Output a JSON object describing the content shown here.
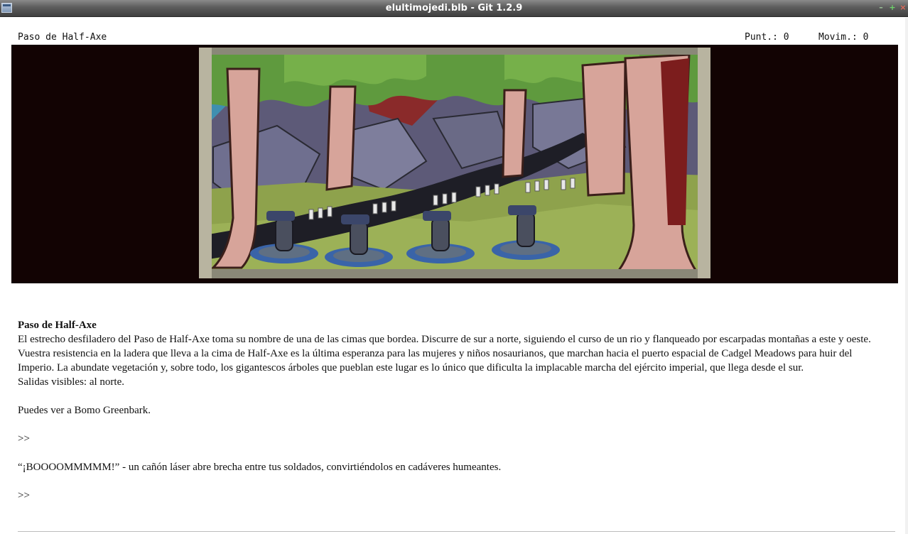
{
  "window": {
    "title": "elultimojedi.blb - Git 1.2.9"
  },
  "status": {
    "location": "Paso de Half-Axe",
    "score": "Punt.: 0",
    "moves": "Movim.: 0"
  },
  "scene": {
    "icon": "forest-scene-illustration",
    "colors": {
      "band": "#120303",
      "sky": "#3f8fb0",
      "foliage": "#5f9a3e",
      "trunk": "#d7a49a",
      "rock": "#6f6f8f",
      "river": "#1e1e26",
      "grass": "#8ea24c"
    }
  },
  "text": {
    "room_title": "Paso de Half-Axe",
    "description": "El estrecho desfiladero del Paso de Half-Axe toma su nombre de una de las cimas que bordea. Discurre de sur a norte, siguiendo el curso de un rio y flanqueado por escarpadas montañas a este y oeste. Vuestra resistencia en la ladera que lleva a la cima de Half-Axe es la última esperanza para las mujeres y niños nosaurianos, que marchan hacia el puerto espacial de Cadgel Meadows para huir del Imperio. La abundate vegetación y, sobre todo, los gigantescos árboles que pueblan este lugar es lo único que dificulta la implacable marcha del ejército imperial, que llega desde el sur.",
    "exits": "Salidas visibles: al norte.",
    "npc": "Puedes ver a Bomo Greenbark.",
    "prompt1": ">>",
    "event": "“¡BOOOOMMMMM!” - un cañón láser abre brecha entre tus soldados, convirtiéndolos en cadáveres humeantes.",
    "prompt2": ">>"
  }
}
